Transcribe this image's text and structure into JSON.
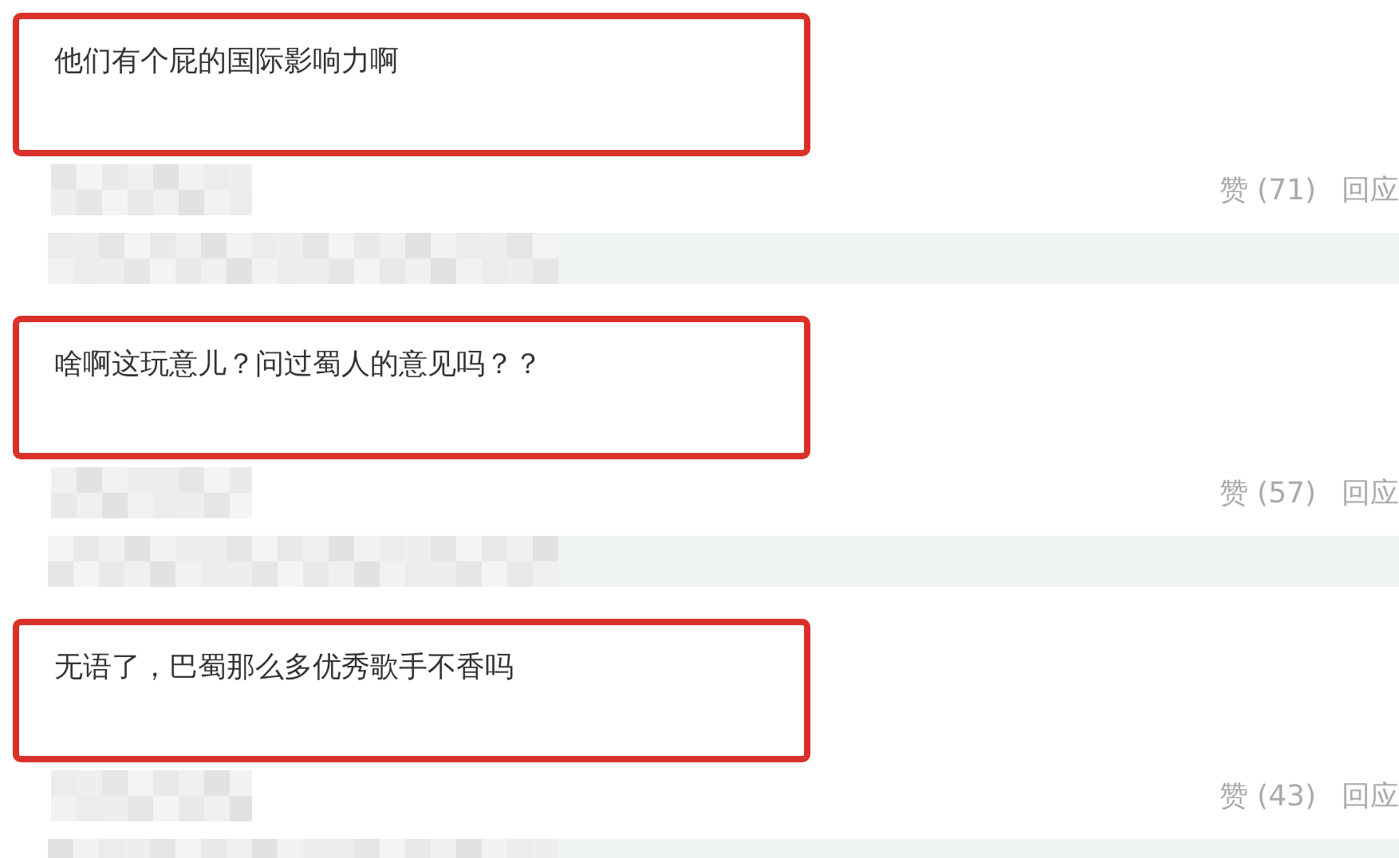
{
  "comments": [
    {
      "text": "他们有个屁的国际影响力啊",
      "highlighted": true,
      "likes": "赞 (71)",
      "reply": "回应"
    },
    {
      "text": "啥啊这玩意儿？问过蜀人的意见吗？？",
      "highlighted": true,
      "likes": "赞 (57)",
      "reply": "回应"
    },
    {
      "text": "无语了，巴蜀那么多优秀歌手不香吗",
      "highlighted": true,
      "likes": "赞 (43)",
      "reply": "回应"
    }
  ]
}
